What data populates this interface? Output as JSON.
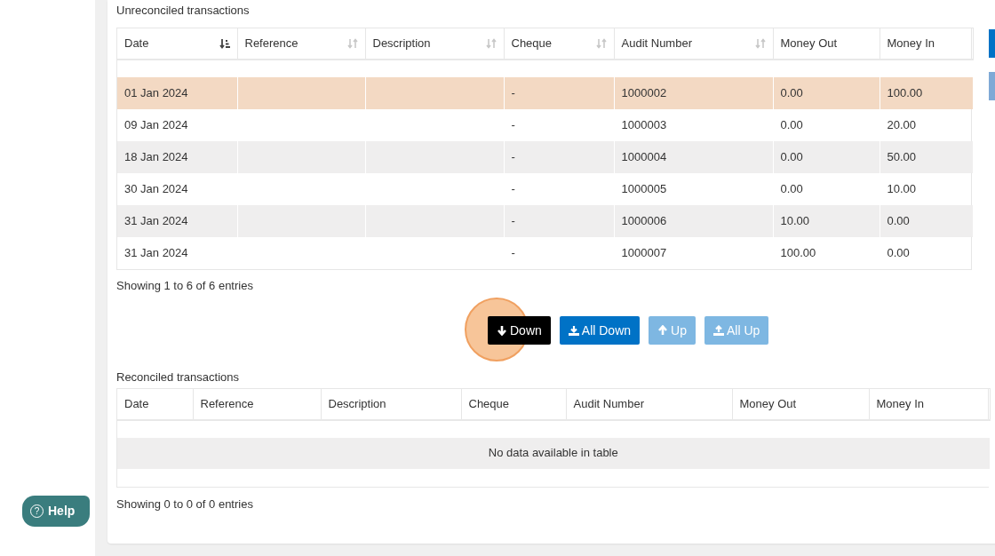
{
  "unreconciled": {
    "title": "Unreconciled transactions",
    "columns": [
      {
        "label": "Date",
        "sortable": true,
        "sorted": true
      },
      {
        "label": "Reference",
        "sortable": true,
        "sorted": false
      },
      {
        "label": "Description",
        "sortable": true,
        "sorted": false
      },
      {
        "label": "Cheque",
        "sortable": true,
        "sorted": false
      },
      {
        "label": "Audit Number",
        "sortable": true,
        "sorted": false
      },
      {
        "label": "Money Out",
        "sortable": false,
        "sorted": false
      },
      {
        "label": "Money In",
        "sortable": false,
        "sorted": false
      }
    ],
    "rows": [
      {
        "cells": [
          "01 Jan 2024",
          "",
          "",
          "-",
          "1000002",
          "0.00",
          "100.00"
        ],
        "selected": true
      },
      {
        "cells": [
          "09 Jan 2024",
          "",
          "",
          "-",
          "1000003",
          "0.00",
          "20.00"
        ],
        "selected": false
      },
      {
        "cells": [
          "18 Jan 2024",
          "",
          "",
          "-",
          "1000004",
          "0.00",
          "50.00"
        ],
        "selected": false
      },
      {
        "cells": [
          "30 Jan 2024",
          "",
          "",
          "-",
          "1000005",
          "0.00",
          "10.00"
        ],
        "selected": false
      },
      {
        "cells": [
          "31 Jan 2024",
          "",
          "",
          "-",
          "1000006",
          "10.00",
          "0.00"
        ],
        "selected": false
      },
      {
        "cells": [
          "31 Jan 2024",
          "",
          "",
          "-",
          "1000007",
          "100.00",
          "0.00"
        ],
        "selected": false
      }
    ],
    "info": "Showing 1 to 6 of 6 entries"
  },
  "actions": [
    {
      "label": "Down",
      "kind": "down",
      "disabled": false,
      "clicked": true
    },
    {
      "label": "All Down",
      "kind": "all-down",
      "disabled": false,
      "clicked": false
    },
    {
      "label": "Up",
      "kind": "up",
      "disabled": true,
      "clicked": false
    },
    {
      "label": "All Up",
      "kind": "all-up",
      "disabled": true,
      "clicked": false
    }
  ],
  "reconciled": {
    "title": "Reconciled transactions",
    "columns": [
      {
        "label": "Date"
      },
      {
        "label": "Reference"
      },
      {
        "label": "Description"
      },
      {
        "label": "Cheque"
      },
      {
        "label": "Audit Number"
      },
      {
        "label": "Money Out"
      },
      {
        "label": "Money In"
      }
    ],
    "empty": "No data available in table",
    "info": "Showing 0 to 0 of 0 entries"
  },
  "side_buttons": [
    {
      "disabled": false
    },
    {
      "disabled": true
    }
  ],
  "help": {
    "icon": "?",
    "label": "Help"
  }
}
